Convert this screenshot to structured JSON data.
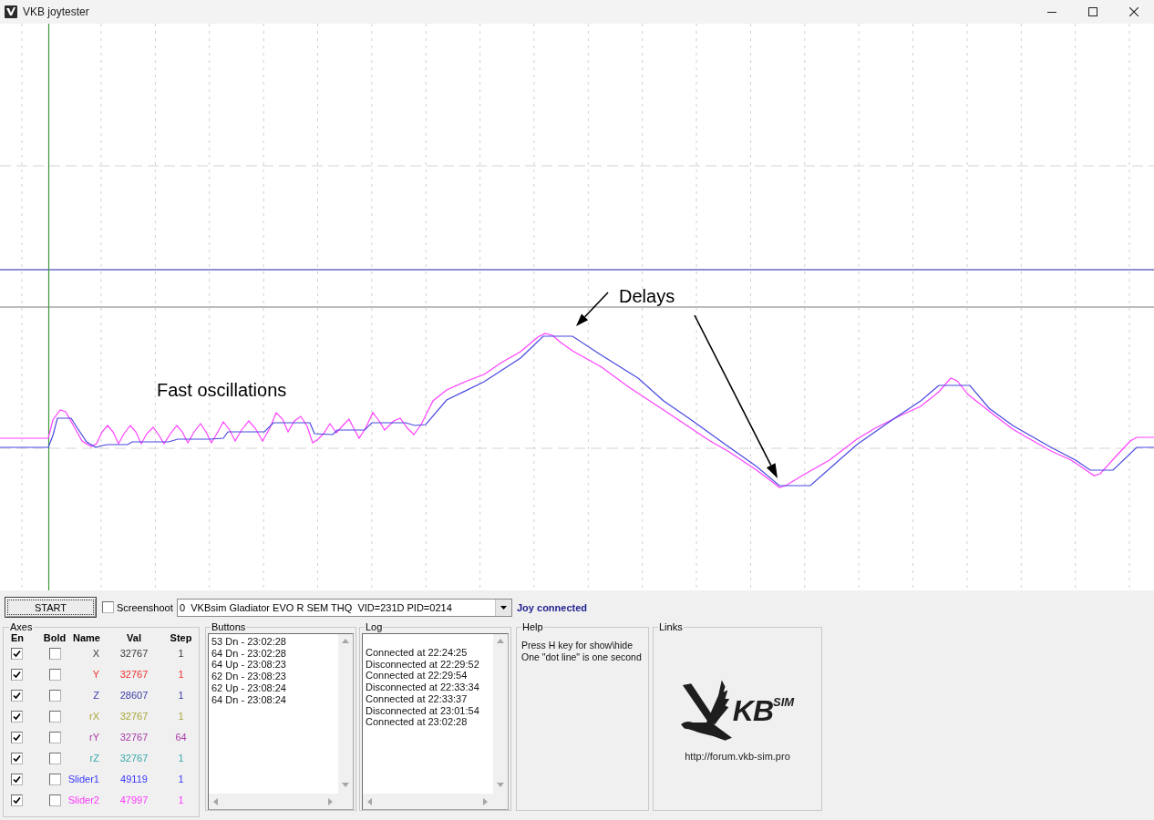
{
  "window": {
    "title": "VKB joytester"
  },
  "plot": {
    "annotations": [
      {
        "text": "Fast oscillations"
      },
      {
        "text": "Delays"
      }
    ]
  },
  "toolbar": {
    "start_button": "START",
    "screenshot": {
      "label": "Screenshoot",
      "checked": false
    },
    "device": {
      "value": "0  VKBsim Gladiator EVO R SEM THQ  VID=231D PID=0214"
    },
    "status": "Joy connected"
  },
  "axes": {
    "title": "Axes",
    "columns": [
      "En",
      "Bold",
      "Name",
      "Val",
      "Step"
    ],
    "rows": [
      {
        "en": true,
        "bold": false,
        "name": "X",
        "val": "32767",
        "step": "1",
        "color": "#3a3a3a"
      },
      {
        "en": true,
        "bold": false,
        "name": "Y",
        "val": "32767",
        "step": "1",
        "color": "#f03030"
      },
      {
        "en": true,
        "bold": false,
        "name": "Z",
        "val": "28607",
        "step": "1",
        "color": "#3a3aa8"
      },
      {
        "en": true,
        "bold": false,
        "name": "rX",
        "val": "32767",
        "step": "1",
        "color": "#a8a838"
      },
      {
        "en": true,
        "bold": false,
        "name": "rY",
        "val": "32767",
        "step": "64",
        "color": "#a838a8"
      },
      {
        "en": true,
        "bold": false,
        "name": "rZ",
        "val": "32767",
        "step": "1",
        "color": "#38a8a8"
      },
      {
        "en": true,
        "bold": false,
        "name": "Slider1",
        "val": "49119",
        "step": "1",
        "color": "#3838ff"
      },
      {
        "en": true,
        "bold": false,
        "name": "Slider2",
        "val": "47997",
        "step": "1",
        "color": "#ff38ff"
      }
    ]
  },
  "buttons": {
    "title": "Buttons",
    "items": [
      "53 Dn - 23:02:28",
      "64 Dn - 23:02:28",
      "64 Up - 23:08:23",
      "62 Dn - 23:08:23",
      "62 Up - 23:08:24",
      "64 Dn - 23:08:24"
    ]
  },
  "log": {
    "title": "Log",
    "items": [
      "Connected at 22:24:25",
      "Disconnected at 22:29:52",
      "Connected at 22:29:54",
      "Disconnected at 22:33:34",
      "Connected at 22:33:37",
      "Disconnected at 23:01:54",
      "Connected at 23:02:28"
    ]
  },
  "help": {
    "title": "Help",
    "lines": [
      "Press H key for show\\hide",
      "One \"dot line\" is one second"
    ]
  },
  "links": {
    "title": "Links",
    "logo": "KB$^{SIM}$",
    "url": "http://forum.vkb-sim.pro"
  }
}
